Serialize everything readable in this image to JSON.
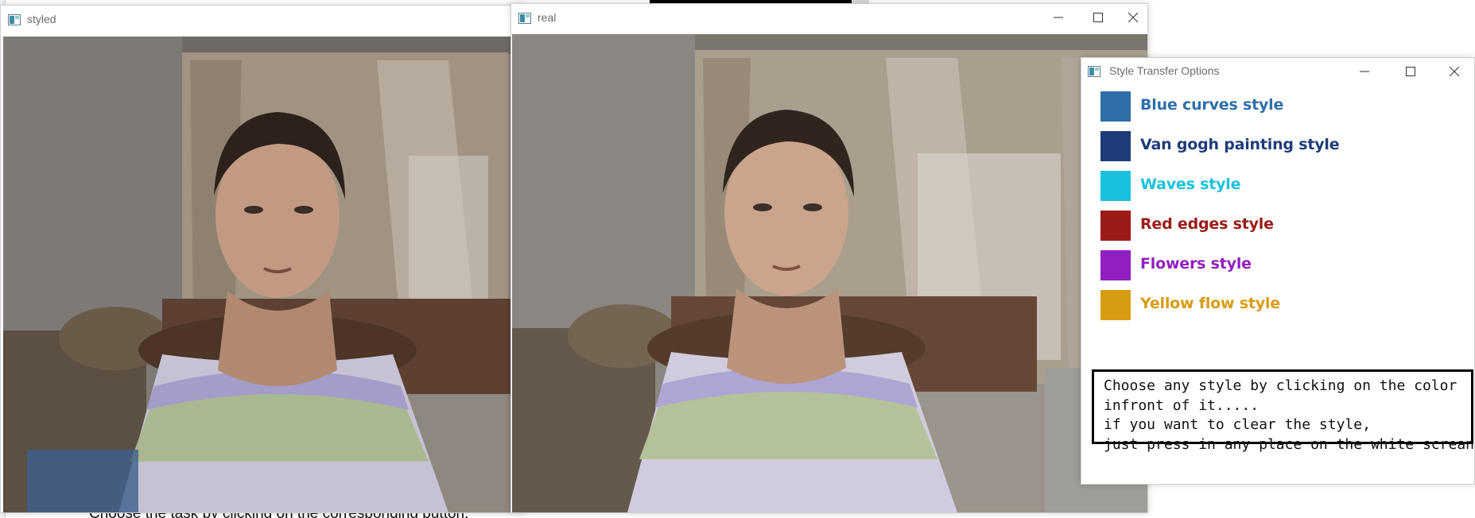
{
  "background": {
    "instruction_text": "Choose the task by clicking on the corresponding button."
  },
  "windows": {
    "styled": {
      "title": "styled"
    },
    "real": {
      "title": "real"
    },
    "options": {
      "title": "Style Transfer Options",
      "items": [
        {
          "label": "Blue curves style",
          "color": "#2e6fa9"
        },
        {
          "label": "Van gogh painting style",
          "color": "#1f3c7a"
        },
        {
          "label": "Waves style",
          "color": "#18c2dc"
        },
        {
          "label": "Red edges style",
          "color": "#9b1b17"
        },
        {
          "label": "Flowers style",
          "color": "#921fc2"
        },
        {
          "label": "Yellow flow style",
          "color": "#d89c13"
        }
      ],
      "info_lines": [
        "Choose any style by clicking on the color",
        "infront of it.....",
        "if you want to clear the style,",
        "just press in any place on the white screan"
      ]
    }
  },
  "icons": {
    "app": "app-window-icon",
    "minimize": "minimize-icon",
    "maximize": "maximize-icon",
    "close": "close-icon"
  }
}
